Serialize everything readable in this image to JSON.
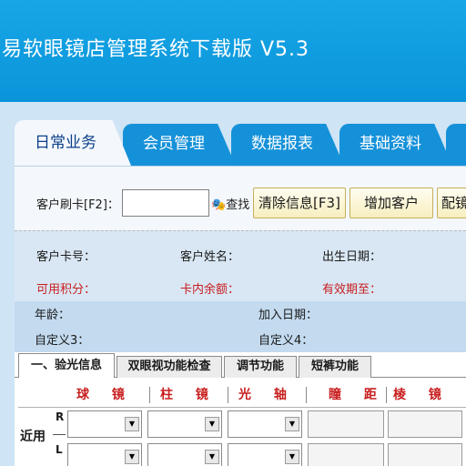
{
  "title": "易软眼镜店管理系统下载版 V5.3",
  "tabs": [
    "日常业务",
    "会员管理",
    "数据报表",
    "基础资料"
  ],
  "search": {
    "label": "客户刷卡[F2]：",
    "value": "",
    "find_label": "查找",
    "binoculars_icon": "binoculars-icon"
  },
  "buttons": {
    "clear": "清除信息[F3]",
    "add_customer": "增加客户",
    "fit": "配镜"
  },
  "info": {
    "card_no": "客户卡号：",
    "name": "客户姓名：",
    "birthday": "出生日期：",
    "points": "可用积分：",
    "balance": "卡内余额：",
    "expiry": "有效期至：",
    "age": "年龄：",
    "join_date": "加入日期：",
    "custom3": "自定义3：",
    "custom4": "自定义4："
  },
  "subtabs": [
    "一、验光信息",
    "双眼视功能检查",
    "调节功能",
    "短裤功能"
  ],
  "grid": {
    "headers": [
      "球 镜",
      "柱 镜",
      "光 轴",
      "瞳 距",
      "棱 镜"
    ],
    "row_label": "近用",
    "right_eye": "R",
    "left_eye": "L"
  },
  "colors": {
    "titlebar": "#0a94da",
    "tab": "#1591d9",
    "accent_red": "#c81e1e"
  }
}
